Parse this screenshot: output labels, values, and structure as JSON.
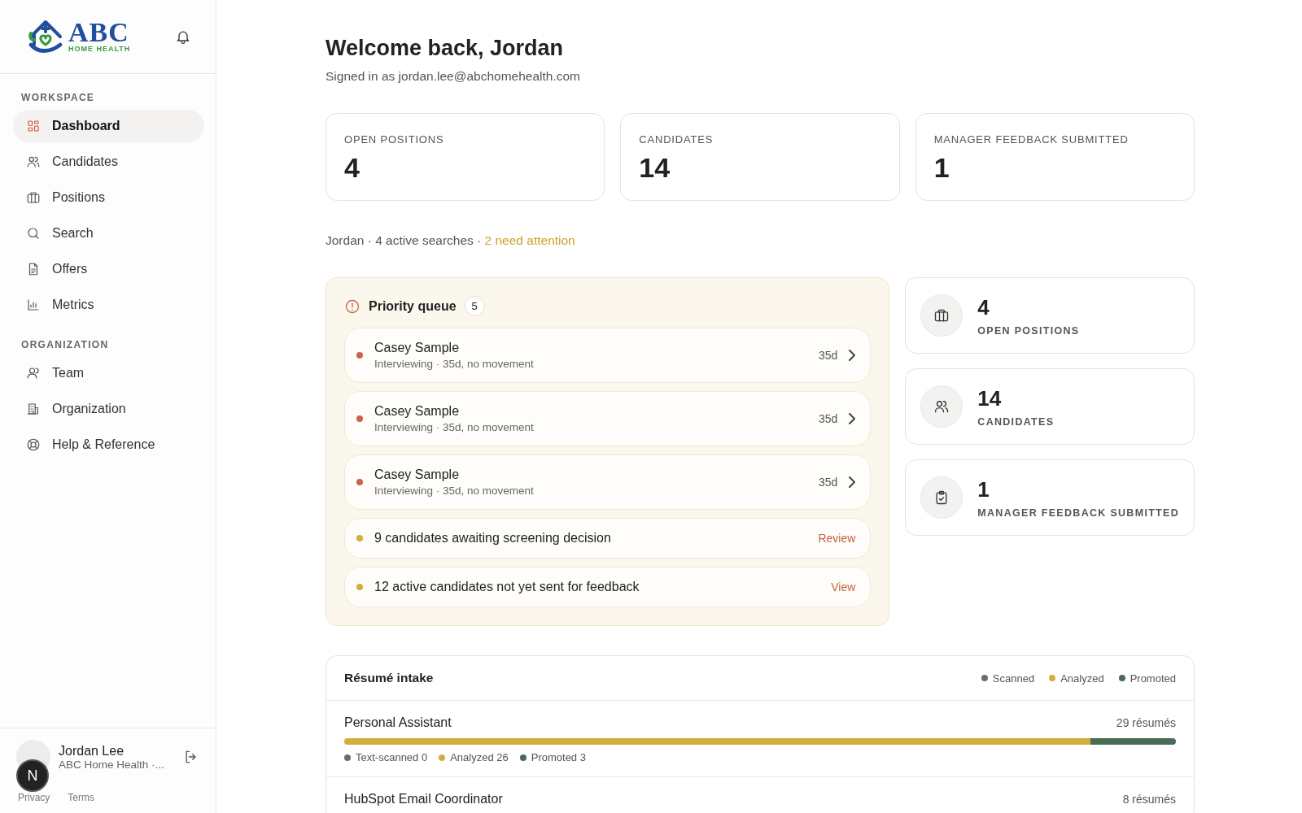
{
  "sidebar": {
    "brand": {
      "name": "ABC",
      "tagline": "HOME HEALTH"
    },
    "sections": [
      {
        "heading": "WORKSPACE",
        "items": [
          {
            "label": "Dashboard",
            "selected": true
          },
          {
            "label": "Candidates",
            "selected": false
          },
          {
            "label": "Positions",
            "selected": false
          },
          {
            "label": "Search",
            "selected": false
          },
          {
            "label": "Offers",
            "selected": false
          },
          {
            "label": "Metrics",
            "selected": false
          }
        ]
      },
      {
        "heading": "ORGANIZATION",
        "items": [
          {
            "label": "Team",
            "selected": false
          },
          {
            "label": "Organization",
            "selected": false
          },
          {
            "label": "Help & Reference",
            "selected": false
          }
        ]
      }
    ],
    "user": {
      "name": "Jordan Lee",
      "org": "ABC Home Health ·..."
    },
    "footer_links": [
      "Privacy",
      "Terms"
    ],
    "dev_badge": "N"
  },
  "header": {
    "title": "Welcome back, Jordan",
    "subtitle": "Signed in as jordan.lee@abchomehealth.com"
  },
  "stats": [
    {
      "label": "OPEN POSITIONS",
      "value": "4"
    },
    {
      "label": "CANDIDATES",
      "value": "14"
    },
    {
      "label": "MANAGER FEEDBACK SUBMITTED",
      "value": "1"
    }
  ],
  "summary": {
    "text": "Jordan · 4 active searches · ",
    "attention": "2 need attention"
  },
  "priority_queue": {
    "title": "Priority queue",
    "count": "5",
    "items": [
      {
        "kind": "candidate",
        "name": "Casey Sample",
        "detail": "Interviewing · 35d, no movement",
        "age": "35d",
        "color": "#c8644a"
      },
      {
        "kind": "candidate",
        "name": "Casey Sample",
        "detail": "Interviewing · 35d, no movement",
        "age": "35d",
        "color": "#c8644a"
      },
      {
        "kind": "candidate",
        "name": "Casey Sample",
        "detail": "Interviewing · 35d, no movement",
        "age": "35d",
        "color": "#c8644a"
      },
      {
        "kind": "task",
        "text": "9 candidates awaiting screening decision",
        "action": "Review",
        "color": "#d4ae3a"
      },
      {
        "kind": "task",
        "text": "12 active candidates not yet sent for feedback",
        "action": "View",
        "color": "#d4ae3a"
      }
    ]
  },
  "side_stats": [
    {
      "value": "4",
      "label": "OPEN POSITIONS"
    },
    {
      "value": "14",
      "label": "CANDIDATES"
    },
    {
      "value": "1",
      "label": "MANAGER FEEDBACK SUBMITTED"
    }
  ],
  "intake": {
    "title": "Résumé intake",
    "legend": [
      {
        "label": "Scanned",
        "color": "#6b6b6b"
      },
      {
        "label": "Analyzed",
        "color": "#d4ae3a"
      },
      {
        "label": "Promoted",
        "color": "#4a6b55"
      }
    ],
    "rows": [
      {
        "title": "Personal Assistant",
        "count": "29 résumés",
        "segments": [
          {
            "label": "Text-scanned 0",
            "level": 0,
            "color": "#6b6b6b"
          },
          {
            "label": "Analyzed 26",
            "level": 0.897,
            "color": "#d4ae3a"
          },
          {
            "label": "Promoted 3",
            "level": 0.103,
            "color": "#4a6b55"
          }
        ]
      },
      {
        "title": "HubSpot Email Coordinator",
        "count": "8 résumés"
      }
    ]
  }
}
